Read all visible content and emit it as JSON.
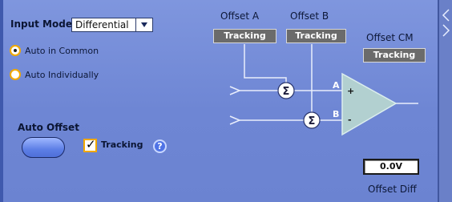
{
  "input_mode": {
    "label": "Input Mode",
    "selected": "Differential"
  },
  "options": [
    {
      "label": "Auto in Common",
      "selected": true
    },
    {
      "label": "Auto Individually",
      "selected": false
    }
  ],
  "auto_offset": {
    "label": "Auto Offset"
  },
  "tracking_checkbox": {
    "label": "Tracking",
    "checked": true,
    "check_glyph": "✓"
  },
  "help": {
    "glyph": "?"
  },
  "offset_a": {
    "label": "Offset A",
    "button": "Tracking"
  },
  "offset_b": {
    "label": "Offset B",
    "button": "Tracking"
  },
  "offset_cm": {
    "label": "Offset CM",
    "button": "Tracking"
  },
  "offset_diff": {
    "label": "Offset Diff",
    "value": "0.0V"
  },
  "diagram": {
    "sum_symbol": "Σ",
    "input_a": "A",
    "input_b": "B",
    "plus": "+",
    "minus": "-"
  },
  "colors": {
    "panel": "#7389d6",
    "accent_orange": "#f2a900",
    "button_gray": "#6b6b6b"
  },
  "icons": {
    "right_bar": [
      "chevron-left-icon",
      "chevron-right-icon"
    ]
  }
}
